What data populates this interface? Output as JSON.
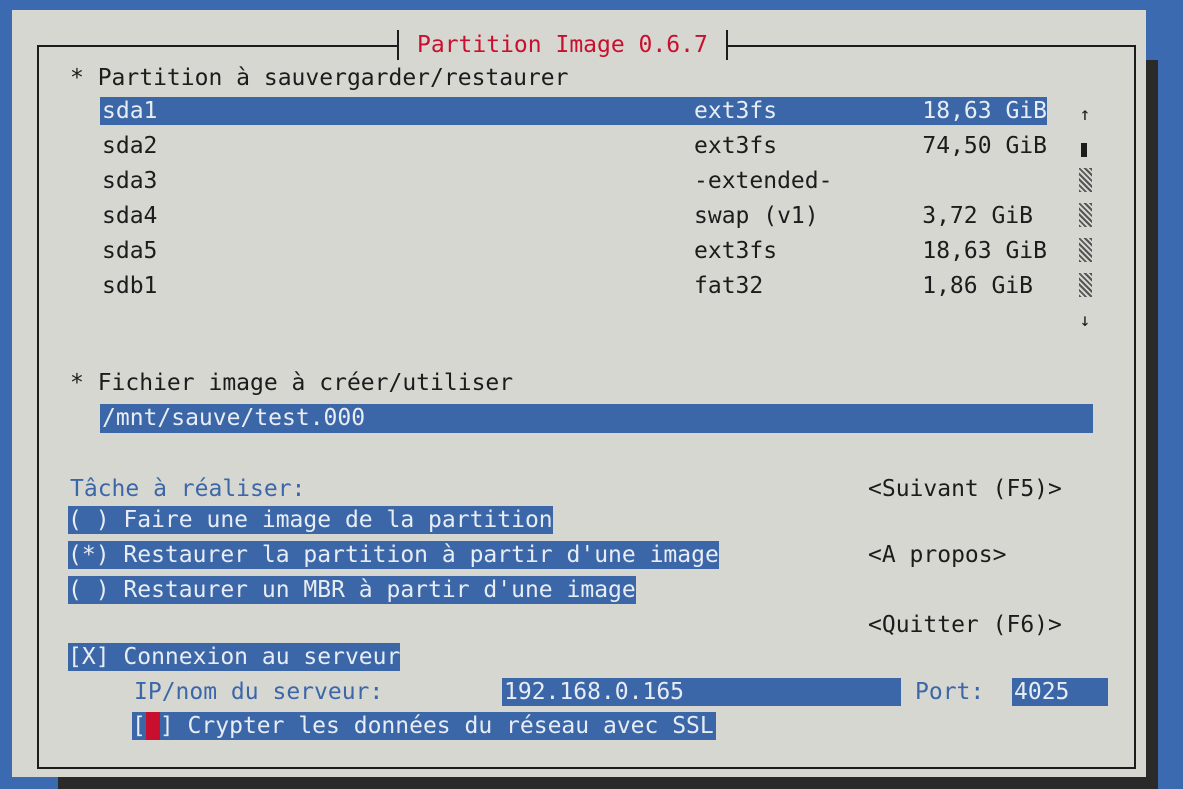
{
  "title": "Partition Image 0.6.7",
  "partition_section": {
    "label": "* Partition à sauvergarder/restaurer",
    "items": [
      {
        "name": "sda1",
        "fs": "ext3fs",
        "size": "18,63 GiB"
      },
      {
        "name": "sda2",
        "fs": "ext3fs",
        "size": "74,50 GiB"
      },
      {
        "name": "sda3",
        "fs": "-extended-",
        "size": ""
      },
      {
        "name": "sda4",
        "fs": "swap (v1)",
        "size": "3,72 GiB"
      },
      {
        "name": "sda5",
        "fs": "ext3fs",
        "size": "18,63 GiB"
      },
      {
        "name": "sdb1",
        "fs": "fat32",
        "size": "1,86 GiB"
      }
    ],
    "scroll_up": "↑",
    "scroll_down": "↓"
  },
  "image_section": {
    "label": "* Fichier image à créer/utiliser",
    "path": "/mnt/sauve/test.000"
  },
  "task_section": {
    "label": "Tâche à réaliser:",
    "options": [
      {
        "text": "( ) Faire une image de la partition"
      },
      {
        "text": "(*) Restaurer la partition à partir d'une image"
      },
      {
        "text": "( ) Restaurer un MBR à partir d'une image"
      }
    ]
  },
  "buttons": {
    "next": "<Suivant (F5)>",
    "about": "<A propos>",
    "quit": "<Quitter (F6)>"
  },
  "server": {
    "connect": "[X] Connexion au serveur",
    "ip_label": "IP/nom du serveur:",
    "ip_value": "192.168.0.165",
    "port_label": "Port:",
    "port_value": "4025",
    "ssl_open": "[",
    "ssl_close": "] Crypter les données du réseau avec SSL"
  },
  "colors": {
    "highlight": "#3b67a8",
    "title": "#c8102e",
    "background": "#3c6ab0",
    "dialog": "#d7d7d2"
  }
}
